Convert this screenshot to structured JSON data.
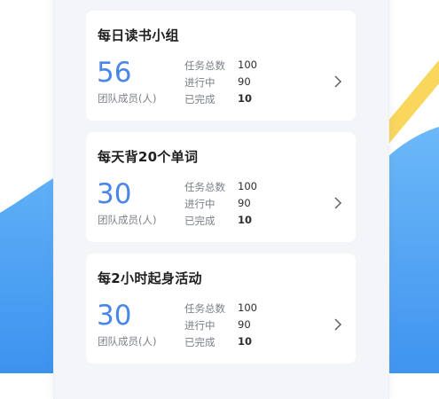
{
  "labels": {
    "members": "团队成员(人)",
    "total_tasks": "任务总数",
    "in_progress": "进行中",
    "completed": "已完成"
  },
  "groups": [
    {
      "title": "每日读书小组",
      "members": "56",
      "total": "100",
      "in_progress": "90",
      "completed": "10"
    },
    {
      "title": "每天背20个单词",
      "members": "30",
      "total": "100",
      "in_progress": "90",
      "completed": "10"
    },
    {
      "title": "每2小时起身活动",
      "members": "30",
      "total": "100",
      "in_progress": "90",
      "completed": "10"
    }
  ],
  "colors": {
    "accent": "#4a86e8",
    "wave_blue": "#5aa8f5",
    "stripe_yellow": "#f9d65c"
  },
  "icons": {
    "chevron": "chevron-right-icon"
  }
}
